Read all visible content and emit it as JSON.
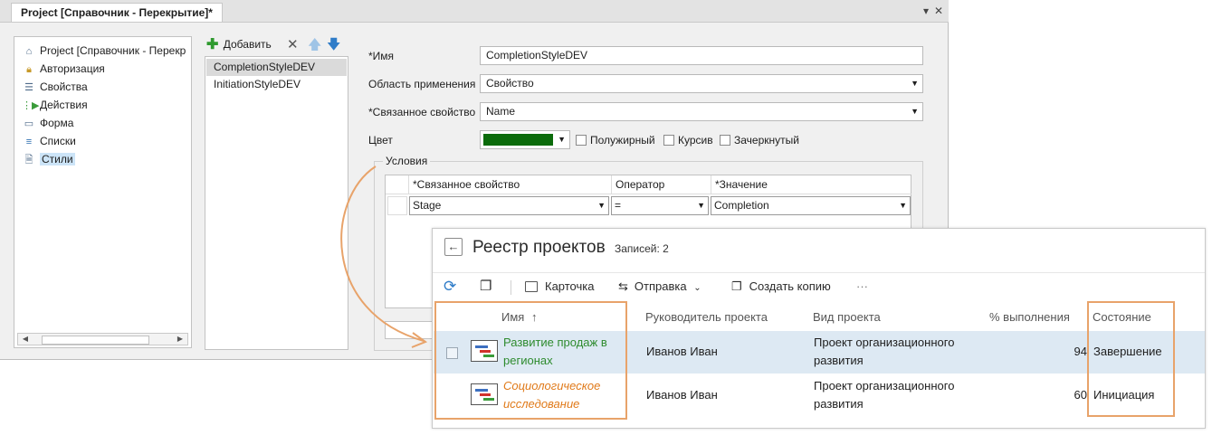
{
  "designer": {
    "tab_title": "Project [Справочник - Перекрытие]*",
    "window_buttons": {
      "pin": "▾",
      "close": "✕"
    },
    "tree": [
      {
        "label": "Project [Справочник - Перекр",
        "icon": "home-icon"
      },
      {
        "label": "Авторизация",
        "icon": "lock-icon"
      },
      {
        "label": "Свойства",
        "icon": "list-icon"
      },
      {
        "label": "Действия",
        "icon": "actions-icon"
      },
      {
        "label": "Форма",
        "icon": "form-icon"
      },
      {
        "label": "Списки",
        "icon": "lists-icon"
      },
      {
        "label": "Стили",
        "icon": "styles-icon",
        "selected": true
      }
    ],
    "toolbar": {
      "add_label": "Добавить"
    },
    "styles": [
      {
        "name": "CompletionStyleDEV",
        "selected": true
      },
      {
        "name": "InitiationStyleDEV"
      }
    ],
    "form": {
      "name_label": "*Имя",
      "name_value": "CompletionStyleDEV",
      "scope_label": "Область применения",
      "scope_value": "Свойство",
      "linked_label": "*Связанное свойство",
      "linked_value": "Name",
      "color_label": "Цвет",
      "color_value": "#0b6b0b",
      "bold_label": "Полужирный",
      "italic_label": "Курсив",
      "strike_label": "Зачеркнутый"
    },
    "conditions": {
      "title": "Условия",
      "headers": [
        "*Связанное свойство",
        "Оператор",
        "*Значение"
      ],
      "row": {
        "property": "Stage",
        "operator": "=",
        "value": "Completion"
      }
    }
  },
  "registry": {
    "title": "Реестр проектов",
    "count": "Записей: 2",
    "toolbar": {
      "card": "Карточка",
      "send": "Отправка",
      "copy": "Создать копию",
      "more": "···"
    },
    "columns": {
      "name": "Имя",
      "sort": "↑",
      "manager": "Руководитель проекта",
      "type": "Вид проекта",
      "percent": "% выполнения",
      "state": "Состояние"
    },
    "rows": [
      {
        "name_line1": "Развитие продаж в",
        "name_line2": "регионах",
        "manager": "Иванов Иван",
        "type_line1": "Проект организационного",
        "type_line2": "развития",
        "percent": "94",
        "state": "Завершение",
        "name_color": "#2e8b2e"
      },
      {
        "name_line1": "Социологическое",
        "name_line2": "исследование",
        "manager": "Иванов Иван",
        "type_line1": "Проект организационного",
        "type_line2": "развития",
        "percent": "60",
        "state": "Инициация",
        "name_color": "#e07a1a"
      }
    ],
    "highlight_color": "#e8a36a"
  }
}
